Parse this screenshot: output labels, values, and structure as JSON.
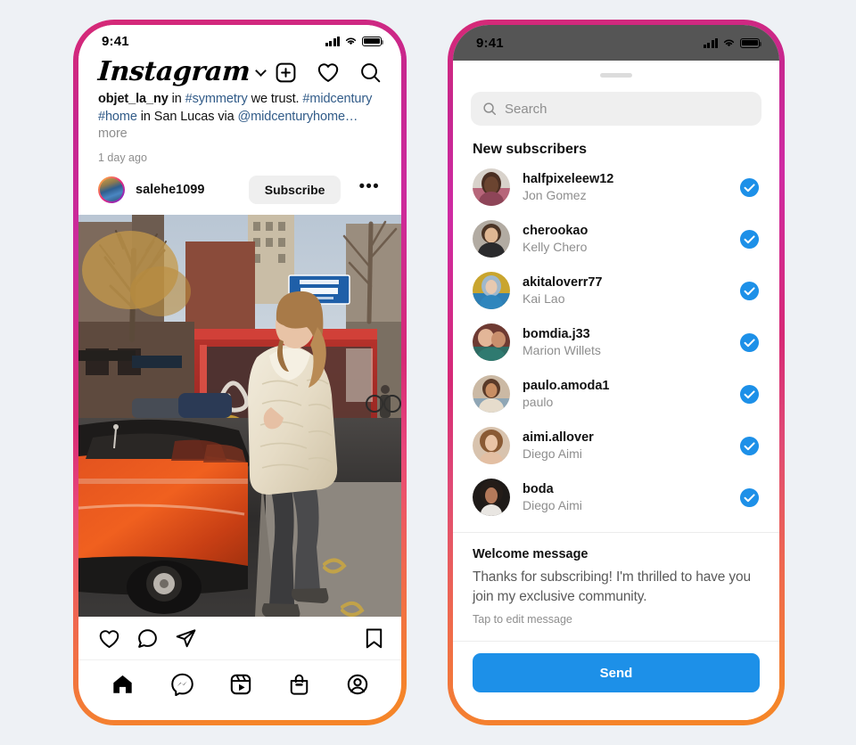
{
  "background_color": "#eef1f5",
  "accent_colors": {
    "gradient_top": "#d62976",
    "gradient_bottom": "#f58529",
    "link_blue": "#315b88",
    "check_blue": "#1d90e8",
    "send_blue": "#1d90e8",
    "muted_gray": "#8e8e8e"
  },
  "left_phone": {
    "status_bar": {
      "time": "9:41",
      "icons": [
        "signal-icon",
        "wifi-icon",
        "battery-icon"
      ]
    },
    "header": {
      "logo_text": "Instagram",
      "chevron": "chevron-down-icon",
      "icons": [
        "new-post-icon",
        "activity-heart-icon",
        "search-icon"
      ]
    },
    "post": {
      "caption": {
        "author": "objet_la_ny",
        "segments": [
          {
            "text": "objet_la_ny",
            "style": "bold"
          },
          {
            "text": " in ",
            "style": "plain"
          },
          {
            "text": "#symmetry",
            "style": "tag"
          },
          {
            "text": " we trust. ",
            "style": "plain"
          },
          {
            "text": "#midcentury",
            "style": "tag"
          },
          {
            "text": " ",
            "style": "plain"
          },
          {
            "text": "#home",
            "style": "tag"
          },
          {
            "text": " in San Lucas via ",
            "style": "plain"
          },
          {
            "text": "@midcenturyhome…",
            "style": "tag"
          },
          {
            "text": " more",
            "style": "more"
          }
        ],
        "full_text": "objet_la_ny in #symmetry we trust. #midcentury #home in San Lucas via @midcenturyhome… more"
      },
      "timestamp": "1 day ago",
      "author_username": "salehe1099",
      "subscribe_label": "Subscribe",
      "more_options": "•••",
      "image_alt": "Woman in cream fur coat walking past an orange classic convertible car on a city street with a red bus shelter covered in graffiti and a blue BUS LANE BUSES ONLY sign",
      "image_sign_line1": "BUS LANE",
      "image_sign_line2": "BUSES ONLY"
    },
    "actions": [
      "like-heart-icon",
      "comment-bubble-icon",
      "share-paperplane-icon",
      "bookmark-icon"
    ],
    "tabbar": [
      "home-icon",
      "messenger-icon",
      "reels-icon",
      "shop-icon",
      "profile-icon"
    ]
  },
  "right_phone": {
    "status_bar": {
      "time": "9:41",
      "icons": [
        "signal-icon",
        "wifi-icon",
        "battery-icon"
      ]
    },
    "sheet": {
      "grabber": "drag-handle",
      "search": {
        "placeholder": "Search",
        "value": "",
        "icon": "search-icon"
      },
      "section_title": "New subscribers",
      "subscribers": [
        {
          "username": "halfpixeleew12",
          "name": "Jon Gomez",
          "selected": true
        },
        {
          "username": "cherookao",
          "name": "Kelly Chero",
          "selected": true
        },
        {
          "username": "akitaloverr77",
          "name": "Kai Lao",
          "selected": true
        },
        {
          "username": "bomdia.j33",
          "name": "Marion Willets",
          "selected": true
        },
        {
          "username": "paulo.amoda1",
          "name": "paulo",
          "selected": true
        },
        {
          "username": "aimi.allover",
          "name": "Diego Aimi",
          "selected": true
        },
        {
          "username": "boda",
          "name": "Diego Aimi",
          "selected": true
        }
      ],
      "welcome": {
        "title": "Welcome message",
        "body": "Thanks for subscribing! I'm thrilled to have you join my exclusive community.",
        "hint": "Tap to edit message"
      },
      "send_label": "Send"
    }
  }
}
